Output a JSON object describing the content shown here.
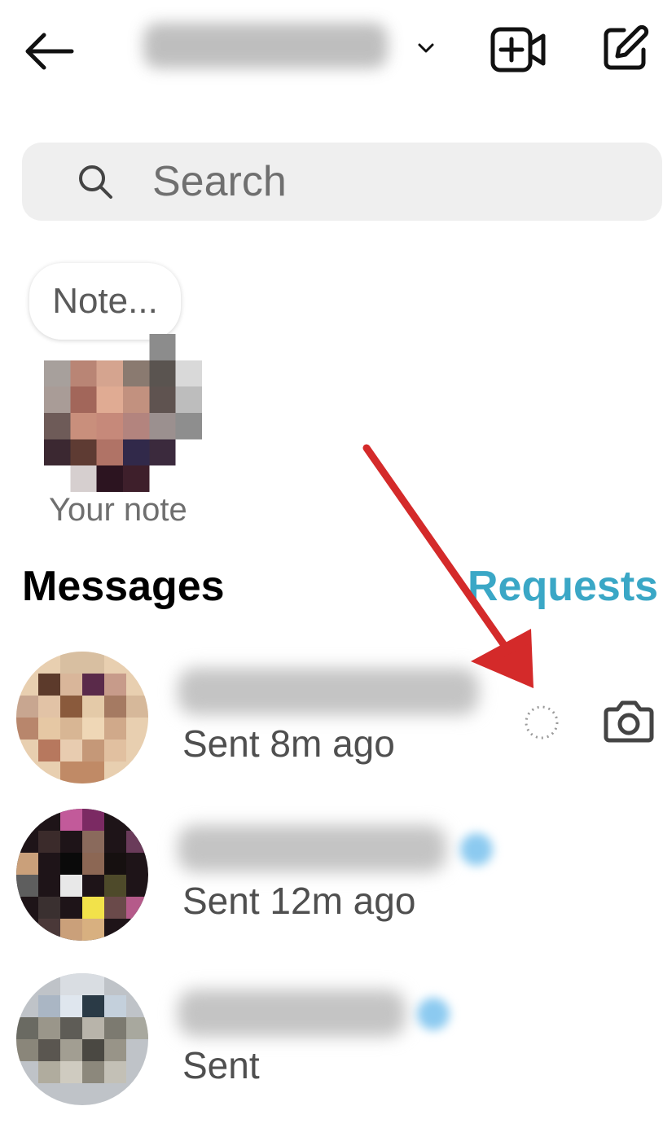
{
  "header": {
    "back_icon": "back-arrow-icon",
    "dropdown_icon": "chevron-down-icon",
    "video_icon": "video-call-plus-icon",
    "compose_icon": "compose-pencil-icon"
  },
  "search": {
    "placeholder": "Search",
    "icon": "search-icon"
  },
  "note": {
    "bubble_text": "Note...",
    "label": "Your note"
  },
  "messages": {
    "heading": "Messages",
    "requests_label": "Requests",
    "accent_color": "#3aa7c6",
    "threads": [
      {
        "status": "Sent 8m ago",
        "has_unseen_dot": false,
        "icons": [
          "loading-ring-icon",
          "camera-icon"
        ]
      },
      {
        "status": "Sent 12m ago",
        "has_unseen_dot": true
      },
      {
        "status": "Sent",
        "has_unseen_dot": true
      }
    ]
  },
  "annotation": {
    "color": "#d42a2a",
    "points_to": "loading-ring-icon"
  }
}
